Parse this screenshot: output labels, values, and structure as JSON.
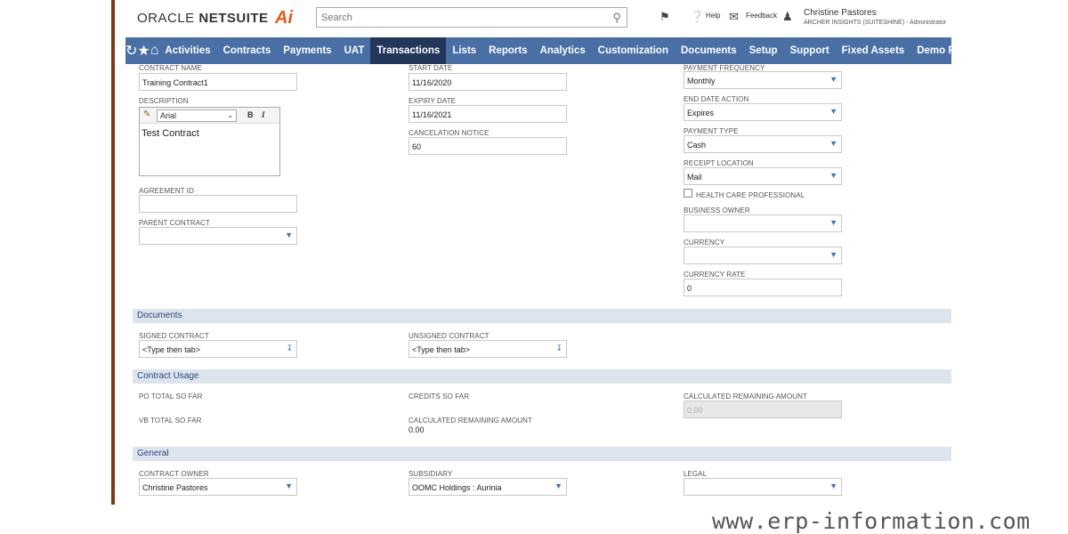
{
  "topbar": {
    "logo_oracle": "ORACLE",
    "logo_netsuite": "NETSUITE",
    "logo_ai": "Ai",
    "search_placeholder": "Search",
    "help": "Help",
    "feedback": "Feedback",
    "user_name": "Christine Pastores",
    "user_role": "ARCHER INSIGHTS (SUITESHINE) - Administrator"
  },
  "nav": {
    "items": [
      "Activities",
      "Contracts",
      "Payments",
      "UAT",
      "Transactions",
      "Lists",
      "Reports",
      "Analytics",
      "Customization",
      "Documents",
      "Setup",
      "Support",
      "Fixed Assets",
      "Demo Framework",
      "..."
    ],
    "active": "Transactions"
  },
  "form": {
    "contract_name_label": "CONTRACT NAME",
    "contract_name": "Training Contract1",
    "description_label": "DESCRIPTION",
    "font": "Arial",
    "bold": "B",
    "italic": "I",
    "description": "Test Contract",
    "agreement_id_label": "AGREEMENT ID",
    "parent_contract_label": "PARENT CONTRACT",
    "start_date_label": "START DATE",
    "start_date": "11/16/2020",
    "expiry_date_label": "EXPIRY DATE",
    "expiry_date": "11/16/2021",
    "cancelation_notice_label": "CANCELATION NOTICE",
    "cancelation_notice": "60",
    "payment_frequency_label": "PAYMENT FREQUENCY",
    "payment_frequency": "Monthly",
    "end_date_action_label": "END DATE ACTION",
    "end_date_action": "Expires",
    "payment_type_label": "PAYMENT TYPE",
    "payment_type": "Cash",
    "receipt_location_label": "RECEIPT LOCATION",
    "receipt_location": "Mail",
    "health_care_label": "HEALTH CARE PROFESSIONAL",
    "business_owner_label": "BUSINESS OWNER",
    "currency_label": "CURRENCY",
    "currency_rate_label": "CURRENCY RATE",
    "currency_rate": "0"
  },
  "documents": {
    "title": "Documents",
    "signed_label": "SIGNED CONTRACT",
    "signed_value": "<Type then tab>",
    "unsigned_label": "UNSIGNED CONTRACT",
    "unsigned_value": "<Type then tab>"
  },
  "usage": {
    "title": "Contract Usage",
    "po_total_label": "PO TOTAL SO FAR",
    "vb_total_label": "VB TOTAL SO FAR",
    "credits_label": "CREDITS SO FAR",
    "calc_remaining_label": "CALCULATED REMAINING AMOUNT",
    "calc_remaining_value": "0.00",
    "calc_remaining_right_label": "CALCULATED REMAINING AMOUNT",
    "calc_remaining_right_value": "0.00"
  },
  "general": {
    "title": "General",
    "contract_owner_label": "CONTRACT OWNER",
    "contract_owner": "Christine Pastores",
    "subsidiary_label": "SUBSIDIARY",
    "subsidiary": "OOMC Holdings : Aurinia",
    "legal_label": "LEGAL"
  },
  "watermark": "www.erp-information.com"
}
